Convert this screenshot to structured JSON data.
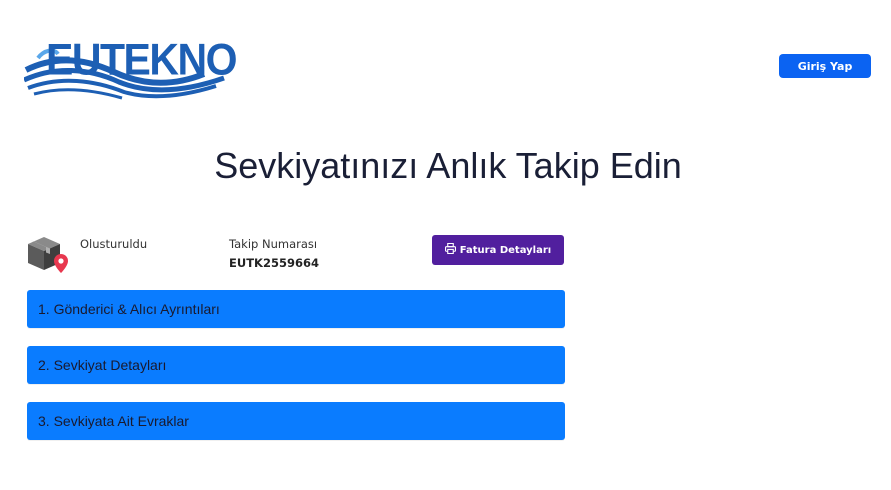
{
  "header": {
    "logo_text": "EUTEKNO",
    "login_label": "Giriş Yap"
  },
  "page": {
    "title": "Sevkiyatınızı Anlık Takip Edin"
  },
  "shipment": {
    "status_icon": "package-location-icon",
    "status": "Olusturuldu",
    "tracking_caption": "Takip Numarası",
    "tracking_number": "EUTK2559664",
    "invoice_icon": "printer-icon",
    "invoice_label": "Fatura Detayları"
  },
  "sections": [
    {
      "label": "1. Gönderici & Alıcı Ayrıntıları"
    },
    {
      "label": "2. Sevkiyat Detayları"
    },
    {
      "label": "3. Sevkiyata Ait Evraklar"
    }
  ],
  "colors": {
    "brand_blue": "#1d5fb4",
    "login_button": "#0b63f2",
    "invoice_button": "#511f9e",
    "accordion": "#0a7cff"
  }
}
